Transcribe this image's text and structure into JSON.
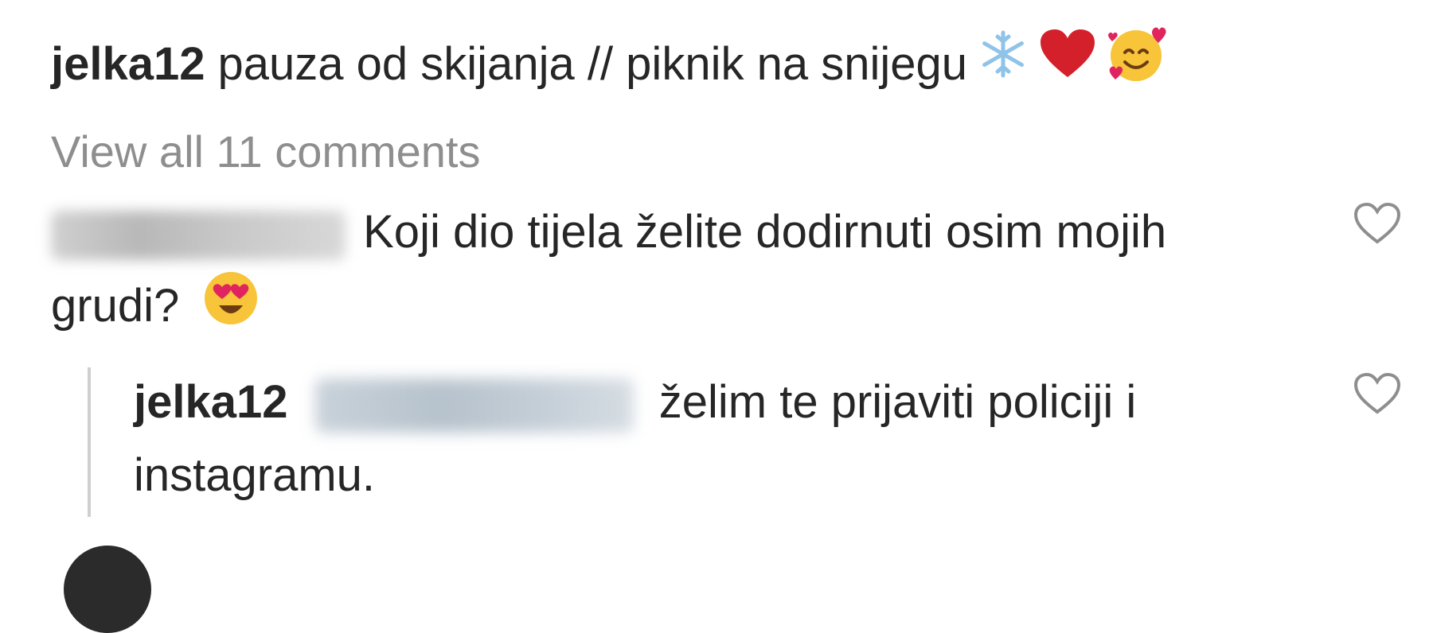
{
  "post": {
    "username": "jelka12",
    "caption_text": "pauza od skijanja // piknik na snijegu",
    "caption_emojis": [
      "snowflake-icon",
      "red-heart-icon",
      "smiling-face-with-hearts-icon"
    ]
  },
  "comments_link": "View all 11 comments",
  "comment": {
    "text": "Koji dio tijela želite dodirnuti osim mojih grudi?",
    "emoji": "heart-eyes-icon",
    "username_redacted": true
  },
  "reply": {
    "username": "jelka12",
    "text": "želim te prijaviti policiji i instagramu.",
    "mention_redacted": true
  },
  "colors": {
    "text": "#262626",
    "muted": "#8e8e8e",
    "thread_line": "#cfcfcf",
    "heart_red": "#d4202a",
    "emoji_yellow": "#f7c43a"
  }
}
